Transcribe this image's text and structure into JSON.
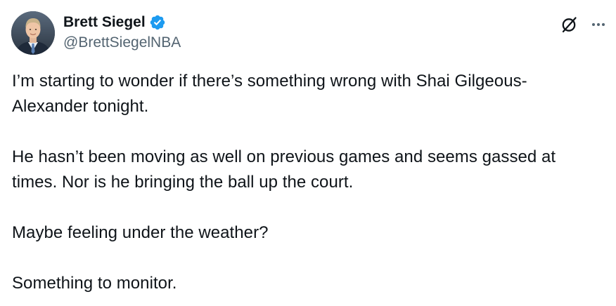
{
  "author": {
    "display_name": "Brett Siegel",
    "handle": "@BrettSiegelNBA",
    "verified": true
  },
  "icons": {
    "verified": "verified-badge-icon",
    "grok": "grok-slash-circle-icon",
    "more": "more-horizontal-icon"
  },
  "colors": {
    "verified_badge": "#1d9bf0",
    "text_primary": "#0f1419",
    "text_secondary": "#536471"
  },
  "tweet": {
    "paragraphs": [
      [
        "I’m starting to wonder if there’s something wrong with Shai Gilgeous-",
        "Alexander tonight."
      ],
      [
        "He hasn’t been moving as well on previous games and seems gassed at",
        "times. Nor is he bringing the ball up the court."
      ],
      [
        "Maybe feeling under the weather?"
      ],
      [
        "Something to monitor."
      ]
    ]
  }
}
